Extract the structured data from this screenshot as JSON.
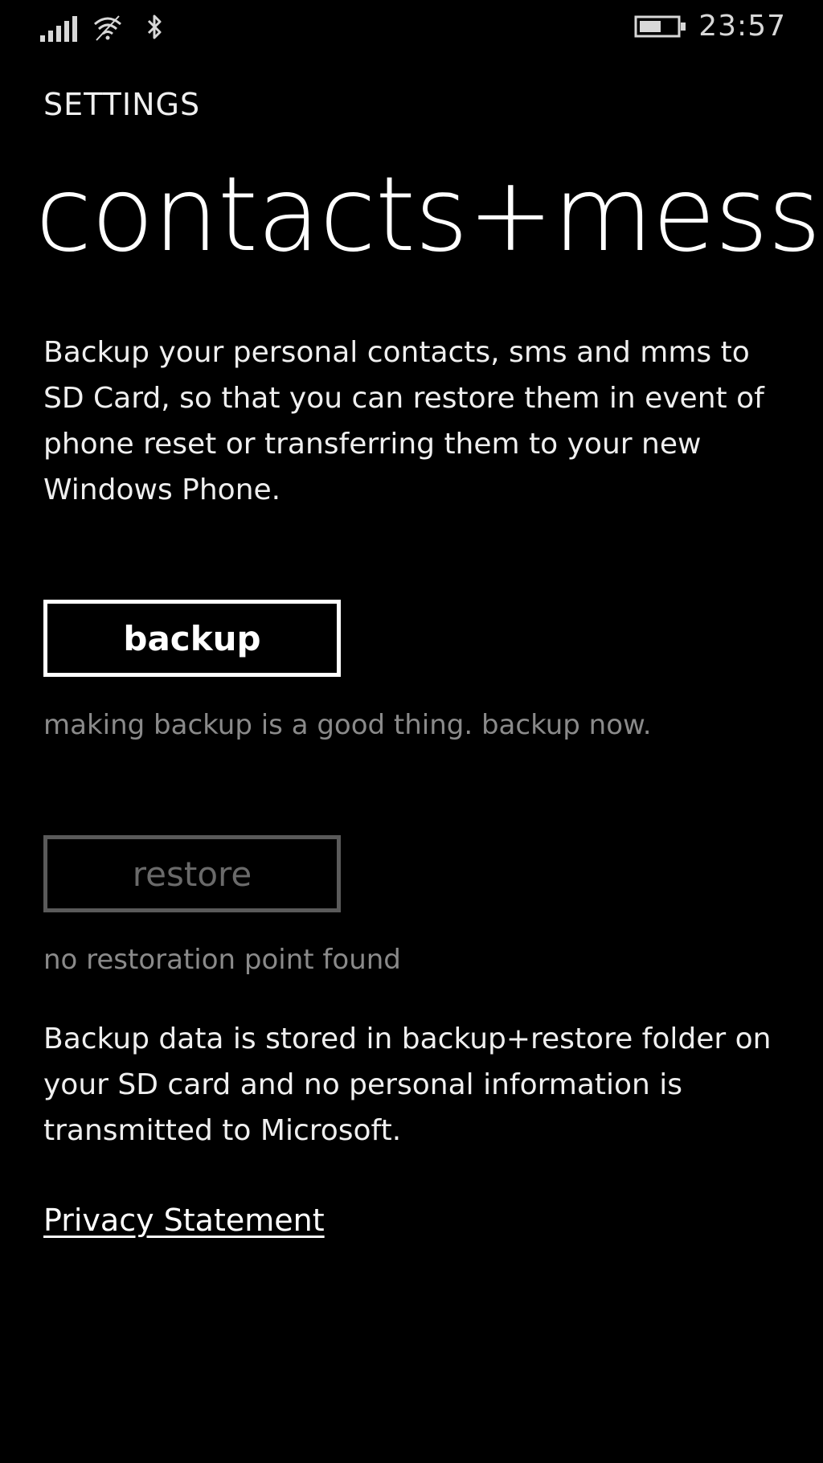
{
  "status_bar": {
    "signal_icon": "signal-strength-icon",
    "wifi_icon": "wifi-icon",
    "bluetooth_icon": "bluetooth-icon",
    "battery_icon": "battery-icon",
    "time": "23:57"
  },
  "header": {
    "section_label": "SETTINGS",
    "title": "contacts+message backup"
  },
  "main": {
    "description": "Backup your personal contacts, sms and mms to SD Card, so that you can restore them in event of phone reset or transferring them to your new Windows Phone.",
    "backup_button_label": "backup",
    "backup_hint": "making backup is a good thing. backup now.",
    "restore_button_label": "restore",
    "restore_hint": "no restoration point found",
    "storage_note": "Backup data is stored in backup+restore folder on your SD card and no personal information is transmitted to Microsoft.",
    "privacy_link": "Privacy Statement"
  }
}
